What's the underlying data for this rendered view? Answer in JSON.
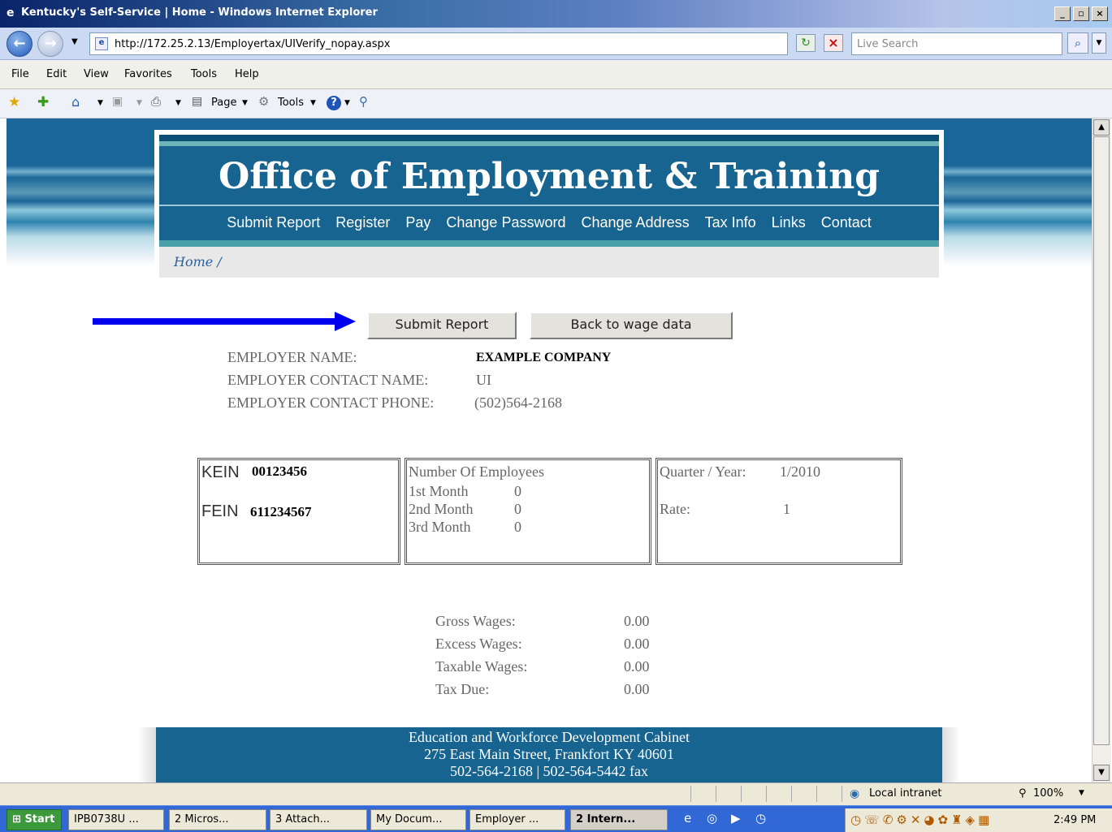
{
  "window": {
    "title": "Kentucky's Self-Service | Home - Windows Internet Explorer",
    "controls": [
      "_",
      "▫",
      "×"
    ]
  },
  "address": {
    "url": "http://172.25.2.13/Employertax/UIVerify_nopay.aspx",
    "search_placeholder": "Live Search"
  },
  "menu": [
    "File",
    "Edit",
    "View",
    "Favorites",
    "Tools",
    "Help"
  ],
  "commands": {
    "page": "Page",
    "tools": "Tools"
  },
  "site": {
    "title": "Office of Employment & Training",
    "nav": [
      "Submit Report",
      "Register",
      "Pay",
      "Change Password",
      "Change Address",
      "Tax Info",
      "Links",
      "Contact"
    ],
    "breadcrumb": "Home /"
  },
  "buttons": {
    "submit": "Submit Report",
    "back": "Back to wage data"
  },
  "employer": {
    "name_label": "EMPLOYER NAME:",
    "name_value": "EXAMPLE COMPANY",
    "contact_label": "EMPLOYER CONTACT NAME:",
    "contact_value": "UI",
    "phone_label": "EMPLOYER CONTACT PHONE:",
    "phone_value": "(502)564-2168"
  },
  "ids": {
    "kein_label": "KEIN",
    "kein_value": "00123456",
    "fein_label": "FEIN",
    "fein_value": "611234567"
  },
  "employees": {
    "heading": "Number Of Employees",
    "rows": [
      {
        "label": "1st Month",
        "value": "0"
      },
      {
        "label": "2nd Month",
        "value": "0"
      },
      {
        "label": "3rd Month",
        "value": "0"
      }
    ]
  },
  "period": {
    "quarter_label": "Quarter / Year:",
    "quarter_value": "1/2010",
    "rate_label": "Rate:",
    "rate_value": "1"
  },
  "wages": [
    {
      "label": "Gross Wages:",
      "value": "0.00"
    },
    {
      "label": "Excess Wages:",
      "value": "0.00"
    },
    {
      "label": "Taxable Wages:",
      "value": "0.00"
    },
    {
      "label": "Tax Due:",
      "value": "0.00"
    }
  ],
  "footer": {
    "line1": "Education and Workforce Development Cabinet",
    "line2": "275 East Main Street, Frankfort KY 40601",
    "line3": "502-564-2168 | 502-564-5442 fax"
  },
  "status": {
    "zone": "Local intranet",
    "zoom": "100%"
  },
  "taskbar": {
    "start": "Start",
    "tasks": [
      "IPB0738U ...",
      "2 Micros...",
      "3 Attach...",
      "My Docum...",
      "Employer ...",
      "2 Intern..."
    ],
    "clock": "2:49 PM"
  },
  "colors": {
    "header_blue": "#16648f",
    "arrow": "#0000ee"
  }
}
